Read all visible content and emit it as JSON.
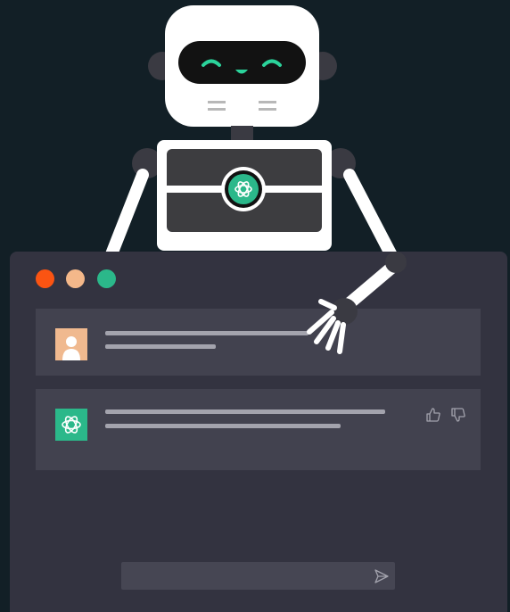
{
  "colors": {
    "background": "#121f26",
    "window": "#333340",
    "message_bg": "#42424f",
    "placeholder_line": "#a3a3ad",
    "accent": "#2bb88a",
    "traffic_red": "#fb5412",
    "traffic_yellow": "#f4b88a",
    "traffic_green": "#2bb88a",
    "user_avatar_bg": "#f0b98f"
  },
  "window": {
    "controls": [
      "close-dot",
      "minimize-dot",
      "maximize-dot"
    ]
  },
  "messages": [
    {
      "role": "user",
      "avatar_icon": "user-avatar-icon"
    },
    {
      "role": "assistant",
      "avatar_icon": "openai-logo-icon",
      "actions": [
        "thumbs-up-icon",
        "thumbs-down-icon"
      ]
    }
  ],
  "composer": {
    "send_icon": "send-icon"
  }
}
